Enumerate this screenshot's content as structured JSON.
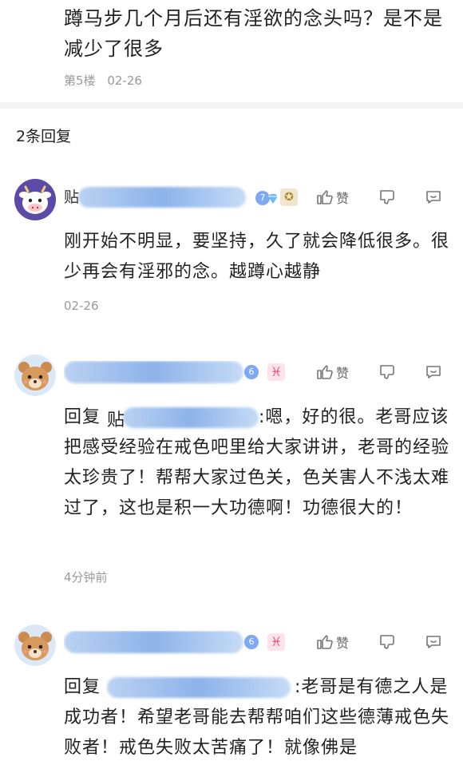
{
  "post": {
    "text": "蹲马步几个月后还有淫欲的念头吗？是不是减少了很多",
    "floor": "第5楼",
    "date": "02-26"
  },
  "reply_count": "2条回复",
  "comments": [
    {
      "username_visible": "贴",
      "user_level": "7",
      "body": "刚开始不明显，要坚持，久了就会降低很多。很少再会有淫邪的念。越蹲心越静",
      "time": "02-26",
      "like_label": "赞",
      "avatar": "cow-avatar"
    },
    {
      "user_level": "6",
      "zodiac": "♓",
      "reply_prefix": "回复",
      "reply_to_visible": "贴",
      "body": ":嗯，好的很。老哥应该把感受经验在戒色吧里给大家讲讲，老哥的经验太珍贵了！帮帮大家过色关，色关害人不浅太难过了，这也是积一大功德啊！功德很大的！",
      "time": "4分钟前",
      "like_label": "赞",
      "avatar": "bear-avatar"
    },
    {
      "user_level": "6",
      "zodiac": "♓",
      "reply_prefix": "回复",
      "body": ":老哥是有德之人是成功者！希望老哥能去帮帮咱们这些德薄戒色失败者！戒色失败太苦痛了！就像佛是",
      "like_label": "赞",
      "avatar": "bear-avatar"
    }
  ]
}
